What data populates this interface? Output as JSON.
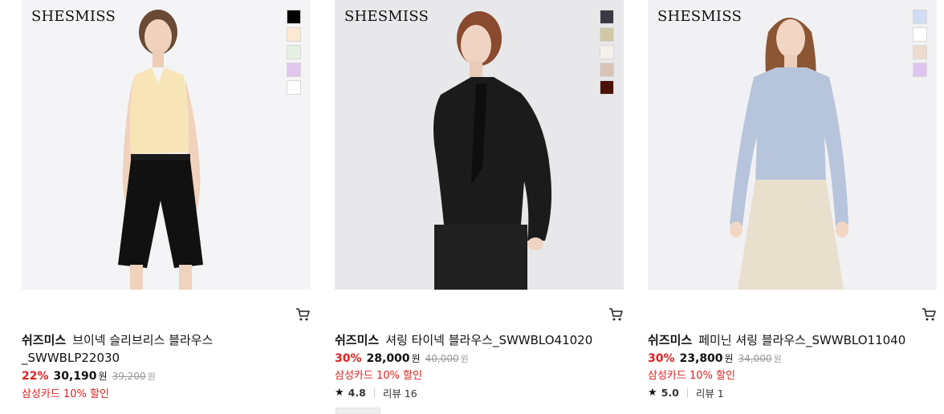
{
  "products": [
    {
      "brand_logo": "SHESMISS",
      "swatches": [
        "#000000",
        "#fde9d1",
        "#e3f0e2",
        "#dfc6ea",
        "#ffffff"
      ],
      "brand": "쉬즈미스",
      "name_line1": "브이넥 슬리브리스 블라우스",
      "name_line2": "_SWWBLP22030",
      "discount": "22%",
      "price": "30,190",
      "currency": "원",
      "original_price": "39,200",
      "original_currency": "원",
      "promo": "삼성카드 10% 할인",
      "cart_icon": "cart-icon"
    },
    {
      "brand_logo": "SHESMISS",
      "swatches": [
        "#3a3a44",
        "#cfc7a6",
        "#f3f1ea",
        "#d8c3b6",
        "#4a1208"
      ],
      "brand": "쉬즈미스",
      "name_line1": "셔링 타이넥 블라우스_SWWBLO41020",
      "discount": "30%",
      "price": "28,000",
      "currency": "원",
      "original_price": "40,000",
      "original_currency": "원",
      "promo": "삼성카드 10% 할인",
      "rating": "4.8",
      "review_label": "리뷰 16",
      "cart_icon": "cart-icon"
    },
    {
      "brand_logo": "SHESMISS",
      "swatches": [
        "#cfdcf2",
        "#ffffff",
        "#ecdccf",
        "#dcc4ee"
      ],
      "brand": "쉬즈미스",
      "name_line1": "페미닌 셔링 블라우스_SWWBLO11040",
      "discount": "30%",
      "price": "23,800",
      "currency": "원",
      "original_price": "34,000",
      "original_currency": "원",
      "promo": "삼성카드 10% 할인",
      "rating": "5.0",
      "review_label": "리뷰 1",
      "cart_icon": "cart-icon"
    }
  ]
}
